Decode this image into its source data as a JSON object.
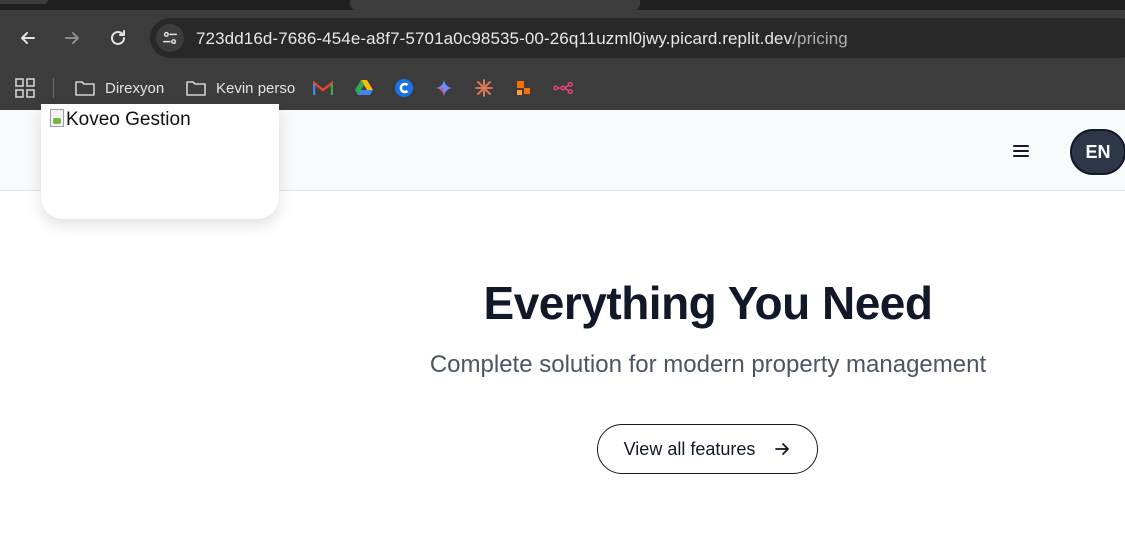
{
  "browser": {
    "url_host": "723dd16d-7686-454e-a8f7-5701a0c98535-00-26q11uzml0jwy.picard.replit.dev",
    "url_path": "/pricing",
    "bookmarks": [
      {
        "label": "Direxyon",
        "icon": "folder-icon"
      },
      {
        "label": "Kevin perso",
        "icon": "folder-icon"
      }
    ],
    "bookmark_icons": [
      "gmail-icon",
      "google-drive-icon",
      "c-app-icon",
      "gemini-icon",
      "claude-icon",
      "zapier-icon",
      "flow-icon"
    ]
  },
  "header": {
    "logo_alt": "Koveo Gestion",
    "language": "EN",
    "menu_icon": "hamburger-icon"
  },
  "hero": {
    "title": "Everything You Need",
    "subtitle": "Complete solution for modern property management",
    "cta_label": "View all features",
    "cta_icon": "arrow-right-icon"
  },
  "colors": {
    "chrome_bg": "#3c3c3c",
    "omnibox_bg": "#282828",
    "header_bg": "#f9fafb",
    "title_color": "#111827",
    "subtitle_color": "#4b5563",
    "lang_bg": "#2d3748"
  }
}
